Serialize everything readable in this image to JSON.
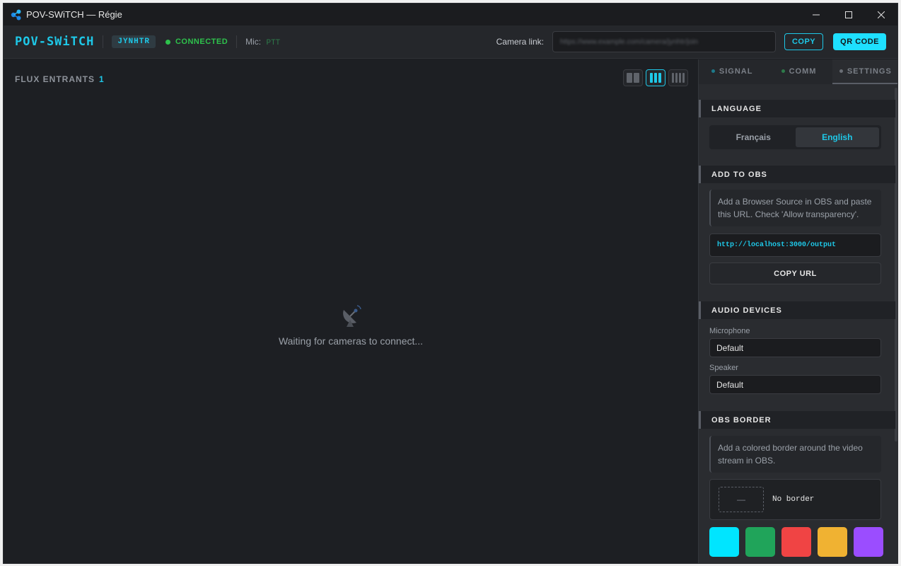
{
  "window": {
    "title": "POV-SWiTCH — Régie"
  },
  "header": {
    "brand": "POV-SWiTCH",
    "room_code": "JYNHTR",
    "status": "CONNECTED",
    "mic_label": "Mic:",
    "mic_mode": "PTT",
    "camera_link_label": "Camera link:",
    "camera_link_value": "https://www.example.com/camera/jynhtr/join",
    "copy_label": "COPY",
    "qr_label": "QR CODE"
  },
  "main": {
    "flux_label": "FLUX ENTRANTS",
    "flux_count": "1",
    "empty_text": "Waiting for cameras to connect...",
    "layouts": [
      "layout-2-columns",
      "layout-3-columns",
      "layout-4-columns"
    ],
    "active_layout": "layout-3-columns"
  },
  "sidebar": {
    "tabs": [
      {
        "label": "SIGNAL",
        "dot_color": "#1e7a8a"
      },
      {
        "label": "COMM",
        "dot_color": "#2e7a4a"
      },
      {
        "label": "SETTINGS",
        "dot_color": "#6a6e75"
      }
    ],
    "active_tab": "SETTINGS",
    "language": {
      "title": "LANGUAGE",
      "options": [
        "Français",
        "English"
      ],
      "selected": "English"
    },
    "obs": {
      "title": "ADD TO OBS",
      "info": "Add a Browser Source in OBS and paste this URL. Check 'Allow transparency'.",
      "url": "http://localhost:3000/output",
      "copy_url_label": "COPY URL"
    },
    "audio": {
      "title": "AUDIO DEVICES",
      "microphone_label": "Microphone",
      "microphone_value": "Default",
      "speaker_label": "Speaker",
      "speaker_value": "Default"
    },
    "border": {
      "title": "OBS BORDER",
      "info": "Add a colored border around the video stream in OBS.",
      "preview_symbol": "—",
      "preview_label": "No border",
      "colors": [
        "#00e5ff",
        "#20a45a",
        "#f04444",
        "#f0b232",
        "#9b4dff"
      ]
    }
  }
}
